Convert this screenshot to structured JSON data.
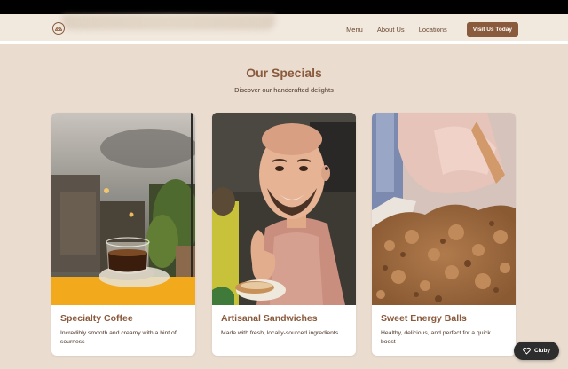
{
  "nav": {
    "links": [
      "Menu",
      "About Us",
      "Locations"
    ],
    "cta": "Visit Us Today"
  },
  "specials": {
    "title": "Our Specials",
    "subtitle": "Discover our handcrafted delights",
    "cards": [
      {
        "title": "Specialty Coffee",
        "desc": "Incredibly smooth and creamy with a hint of sourness"
      },
      {
        "title": "Artisanal Sandwiches",
        "desc": "Made with fresh, locally-sourced ingredients"
      },
      {
        "title": "Sweet Energy Balls",
        "desc": "Healthy, delicious, and perfect for a quick boost"
      }
    ]
  },
  "widget": {
    "label": "Cluby",
    "icon": "heart-icon"
  },
  "colors": {
    "accent": "#8a5a3c",
    "background": "#eaddd0"
  }
}
